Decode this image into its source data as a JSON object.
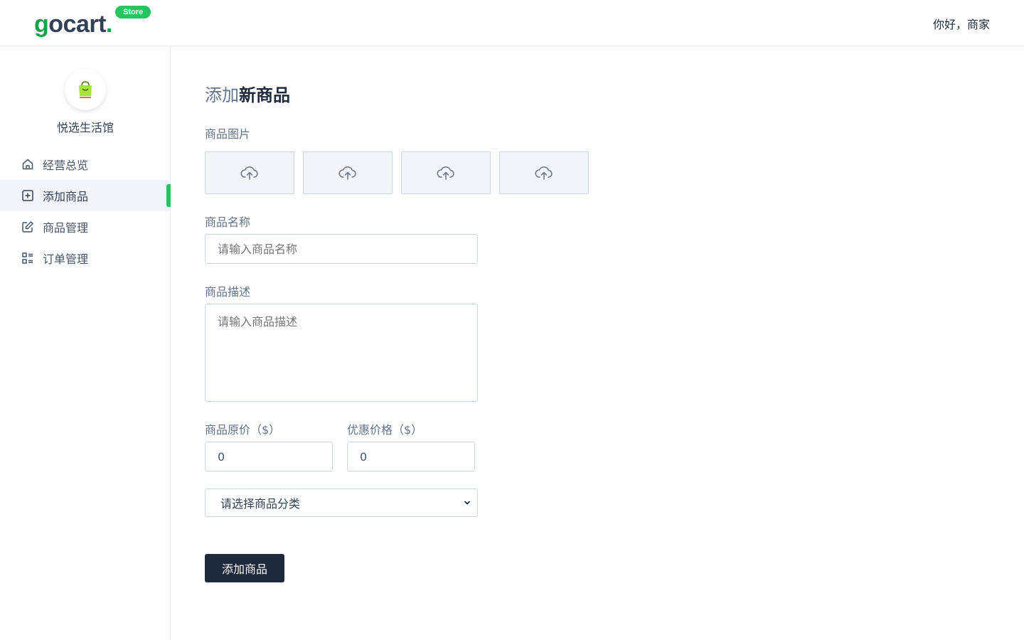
{
  "header": {
    "logo_main": "gocart",
    "logo_badge": "Store",
    "greeting": "你好，商家"
  },
  "sidebar": {
    "store_name": "悦选生活馆",
    "avatar_icon": "shopping-bag-icon",
    "items": [
      {
        "label": "经营总览",
        "icon": "home-icon",
        "active": false
      },
      {
        "label": "添加商品",
        "icon": "square-plus-icon",
        "active": true
      },
      {
        "label": "商品管理",
        "icon": "edit-icon",
        "active": false
      },
      {
        "label": "订单管理",
        "icon": "list-icon",
        "active": false
      }
    ]
  },
  "main": {
    "title_light": "添加",
    "title_bold": "新商品",
    "images_label": "商品图片",
    "upload_icon": "cloud-upload-icon",
    "name_label": "商品名称",
    "name_placeholder": "请输入商品名称",
    "desc_label": "商品描述",
    "desc_placeholder": "请输入商品描述",
    "price_label": "商品原价（$）",
    "price_value": "0",
    "sale_label": "优惠价格（$）",
    "sale_value": "0",
    "category_selected": "请选择商品分类",
    "submit_label": "添加商品"
  },
  "colors": {
    "accent": "#22c55e",
    "dark_button": "#1e293b"
  }
}
